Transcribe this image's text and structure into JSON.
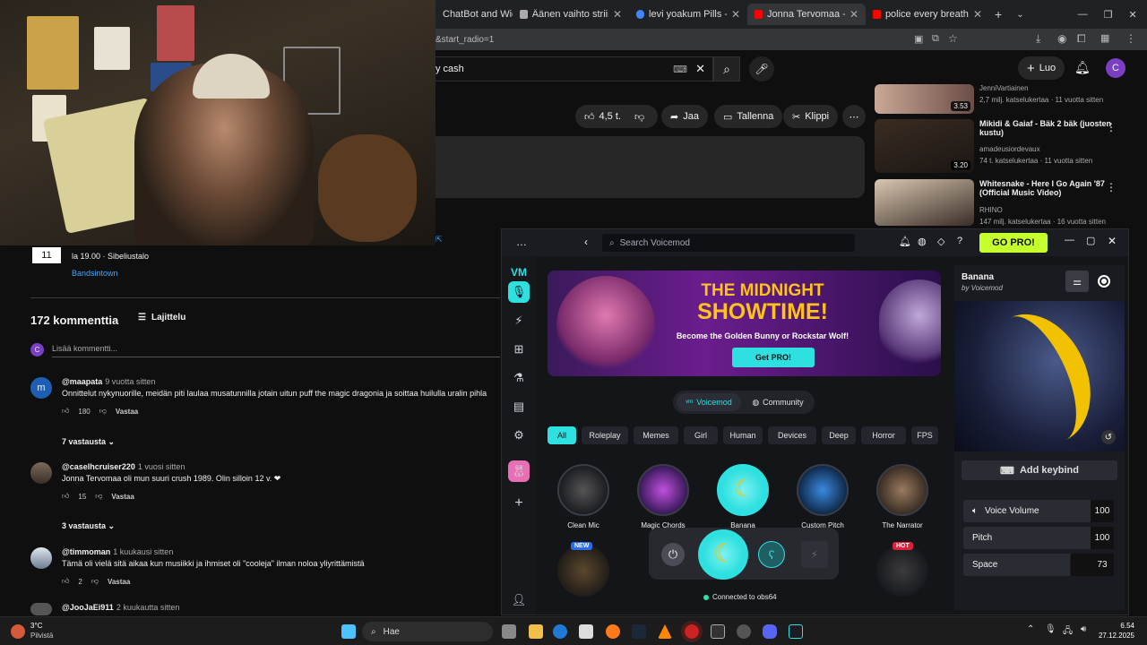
{
  "browser": {
    "tabs": [
      {
        "label": "ChatBot and Widç",
        "color": "#8ab4f8"
      },
      {
        "label": "Äänen vaihto striimauksess",
        "color": "#aaaaaa"
      },
      {
        "label": "levi yoakum Pills - Google-h",
        "color": "#4285f4"
      },
      {
        "label": "Jonna Tervomaa - Rakkaud",
        "color": "#ff0000"
      },
      {
        "label": "police every breath you tak",
        "color": "#ff0000"
      }
    ],
    "url_fragment": "&start_radio=1",
    "search_query": "y cash",
    "create_label": "Luo",
    "avatar_letter": "C"
  },
  "video_actions": {
    "likes": "4,5 t.",
    "share": "Jaa",
    "save": "Tallenna",
    "clip": "Klippi"
  },
  "event": {
    "date_number": "11",
    "detail": "la 19.00 · Sibeliustalo",
    "provider": "Bandsintown"
  },
  "comments_header": {
    "count": "172 kommenttia",
    "sort": "Lajittelu",
    "add_placeholder": "Lisää kommentti...",
    "avatar_letter": "C"
  },
  "comments": [
    {
      "author": "@maapata",
      "time": "9 vuotta sitten",
      "text": "Onnittelut nykynuorille, meidän piti laulaa musatunnilla jotain uitun puff the magic dragonia ja soittaa huilulla uralin pihla",
      "likes": "180",
      "reply": "Vastaa",
      "replies": "7 vastausta",
      "avatar_letter": "m"
    },
    {
      "author": "@caselhcruiser220",
      "time": "1 vuosi sitten",
      "text": "Jonna Tervomaa oli mun suuri crush 1989. Olin silloin 12 v. ❤",
      "likes": "15",
      "reply": "Vastaa",
      "replies": "3 vastausta"
    },
    {
      "author": "@timmoman",
      "time": "1 kuukausi sitten",
      "text": "Tämä oli vielä sitä aikaa kun musiikki ja ihmiset oli \"cooleja\" ilman noloa yliyrittämistä",
      "likes": "2",
      "reply": "Vastaa"
    },
    {
      "author": "@JooJaEi911",
      "time": "2 kuukautta sitten"
    }
  ],
  "related": [
    {
      "title": "",
      "channel": "JenniVartiainen",
      "meta": "2,7 milj. katselukertaa · 11 vuotta sitten",
      "duration": "3.53"
    },
    {
      "title": "Mikidi & Gaiaf - Bäk 2 bäk (juosten kustu)",
      "channel": "amadeusiordevaux",
      "meta": "74 t. katselukertaa · 11 vuotta sitten",
      "duration": "3.20"
    },
    {
      "title": "Whitesnake - Here I Go Again '87 (Official Music Video)",
      "channel": "RHINO",
      "meta": "147 milj. katselukertaa · 16 vuotta sitten"
    }
  ],
  "voicemod": {
    "search_placeholder": "Search Voicemod",
    "go_pro": "GO PRO!",
    "banner": {
      "title1": "THE MIDNIGHT",
      "title2": "SHOWTIME!",
      "subtitle": "Become the Golden Bunny or Rockstar Wolf!",
      "cta": "Get PRO!"
    },
    "toggle": {
      "voicemod": "Voicemod",
      "community": "Community"
    },
    "filters": [
      "All",
      "Roleplay",
      "Memes",
      "Girl",
      "Human",
      "Devices",
      "Deep",
      "Horror",
      "FPS"
    ],
    "voices": [
      {
        "label": "Clean Mic"
      },
      {
        "label": "Magic Chords"
      },
      {
        "label": "Banana"
      },
      {
        "label": "Custom Pitch"
      },
      {
        "label": "The Narrator"
      }
    ],
    "badges": {
      "new": "NEW",
      "hot": "HOT"
    },
    "status": "Connected to obs64",
    "selected": {
      "name": "Banana",
      "by": "by Voicemod"
    },
    "add_keybind": "Add keybind",
    "sliders": [
      {
        "label": "Voice Volume",
        "value": "100"
      },
      {
        "label": "Pitch",
        "value": "100"
      },
      {
        "label": "Space",
        "value": "73"
      }
    ],
    "accent": "#2fe0e0",
    "pro_color": "#c6ff2e"
  },
  "taskbar": {
    "weather_temp": "3°C",
    "weather_desc": "Pilvistä",
    "search": "Hae",
    "time": "6.54",
    "date": "27.12.2025"
  }
}
